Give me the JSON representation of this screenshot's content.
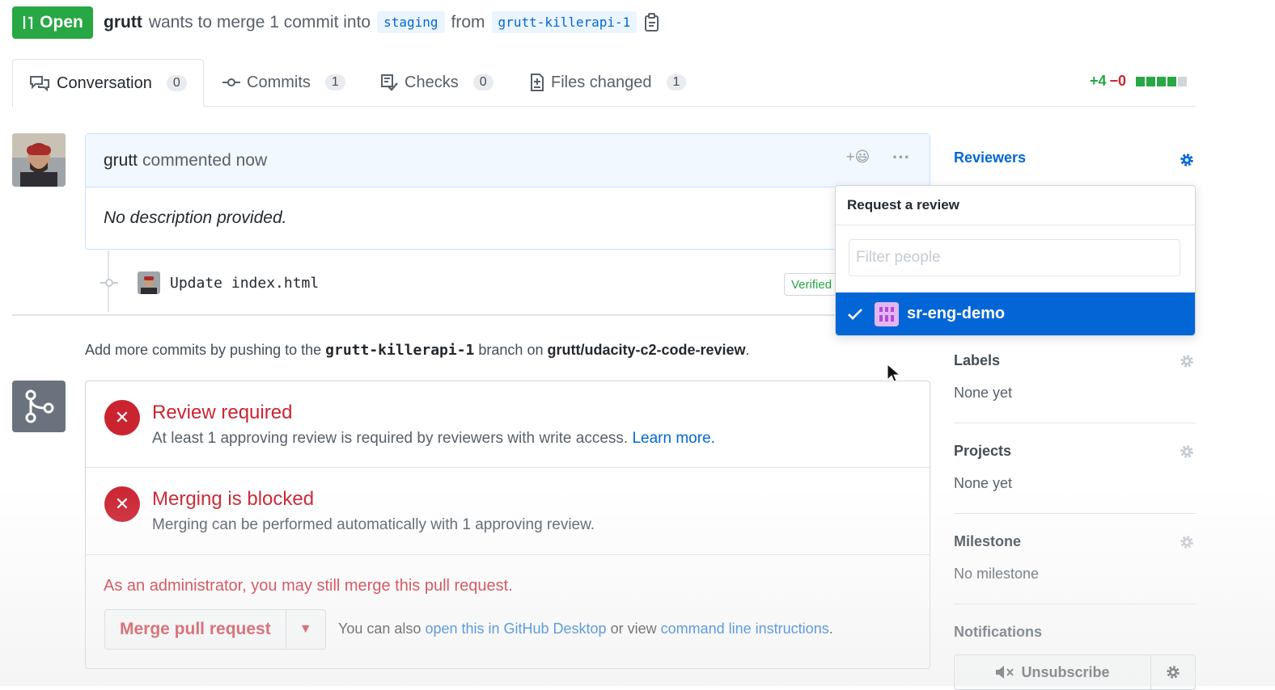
{
  "header": {
    "status_badge": "Open",
    "author": "grutt",
    "wants_text": "wants to merge 1 commit into",
    "base_branch": "staging",
    "from_text": "from",
    "head_branch": "grutt-killerapi-1",
    "copy_icon": "clipboard-icon"
  },
  "tabs": [
    {
      "label": "Conversation",
      "count": "0",
      "icon": "comment-discussion-icon"
    },
    {
      "label": "Commits",
      "count": "1",
      "icon": "git-commit-icon"
    },
    {
      "label": "Checks",
      "count": "0",
      "icon": "checklist-icon"
    },
    {
      "label": "Files changed",
      "count": "1",
      "icon": "file-diff-icon"
    }
  ],
  "diffstat": {
    "additions": "+4",
    "deletions": "−0",
    "blocks": [
      "#28a745",
      "#28a745",
      "#28a745",
      "#28a745",
      "#d1d5da"
    ]
  },
  "comment": {
    "author": "grutt",
    "action": "commented now",
    "body": "No description provided.",
    "reaction_icon": "+😃",
    "more_icon": "···"
  },
  "commit": {
    "message": "Update index.html",
    "verified": "Verified"
  },
  "add_more": {
    "prefix": "Add more commits by pushing to the",
    "branch": "grutt-killerapi-1",
    "mid": "branch on",
    "repo": "grutt/udacity-c2-code-review",
    "suffix": "."
  },
  "merge": {
    "review_title": "Review required",
    "review_text": "At least 1 approving review is required by reviewers with write access.",
    "learn_more": "Learn more.",
    "blocked_title": "Merging is blocked",
    "blocked_text": "Merging can be performed automatically with 1 approving review.",
    "admin_note": "As an administrator, you may still merge this pull request.",
    "merge_button": "Merge pull request",
    "also_prefix": "You can also",
    "desktop_link": "open this in GitHub Desktop",
    "or_view": "or view",
    "cli_link": "command line instructions",
    "also_suffix": "."
  },
  "sidebar": {
    "reviewers": "Reviewers",
    "labels": "Labels",
    "labels_value": "None yet",
    "projects": "Projects",
    "projects_value": "None yet",
    "milestone": "Milestone",
    "milestone_value": "No milestone",
    "notifications": "Notifications",
    "unsubscribe": "Unsubscribe"
  },
  "review_popup": {
    "title": "Request a review",
    "filter_placeholder": "Filter people",
    "selected_team": "sr-eng-demo"
  },
  "colors": {
    "green": "#28a745",
    "red": "#cb2431",
    "blue": "#0366d6"
  }
}
